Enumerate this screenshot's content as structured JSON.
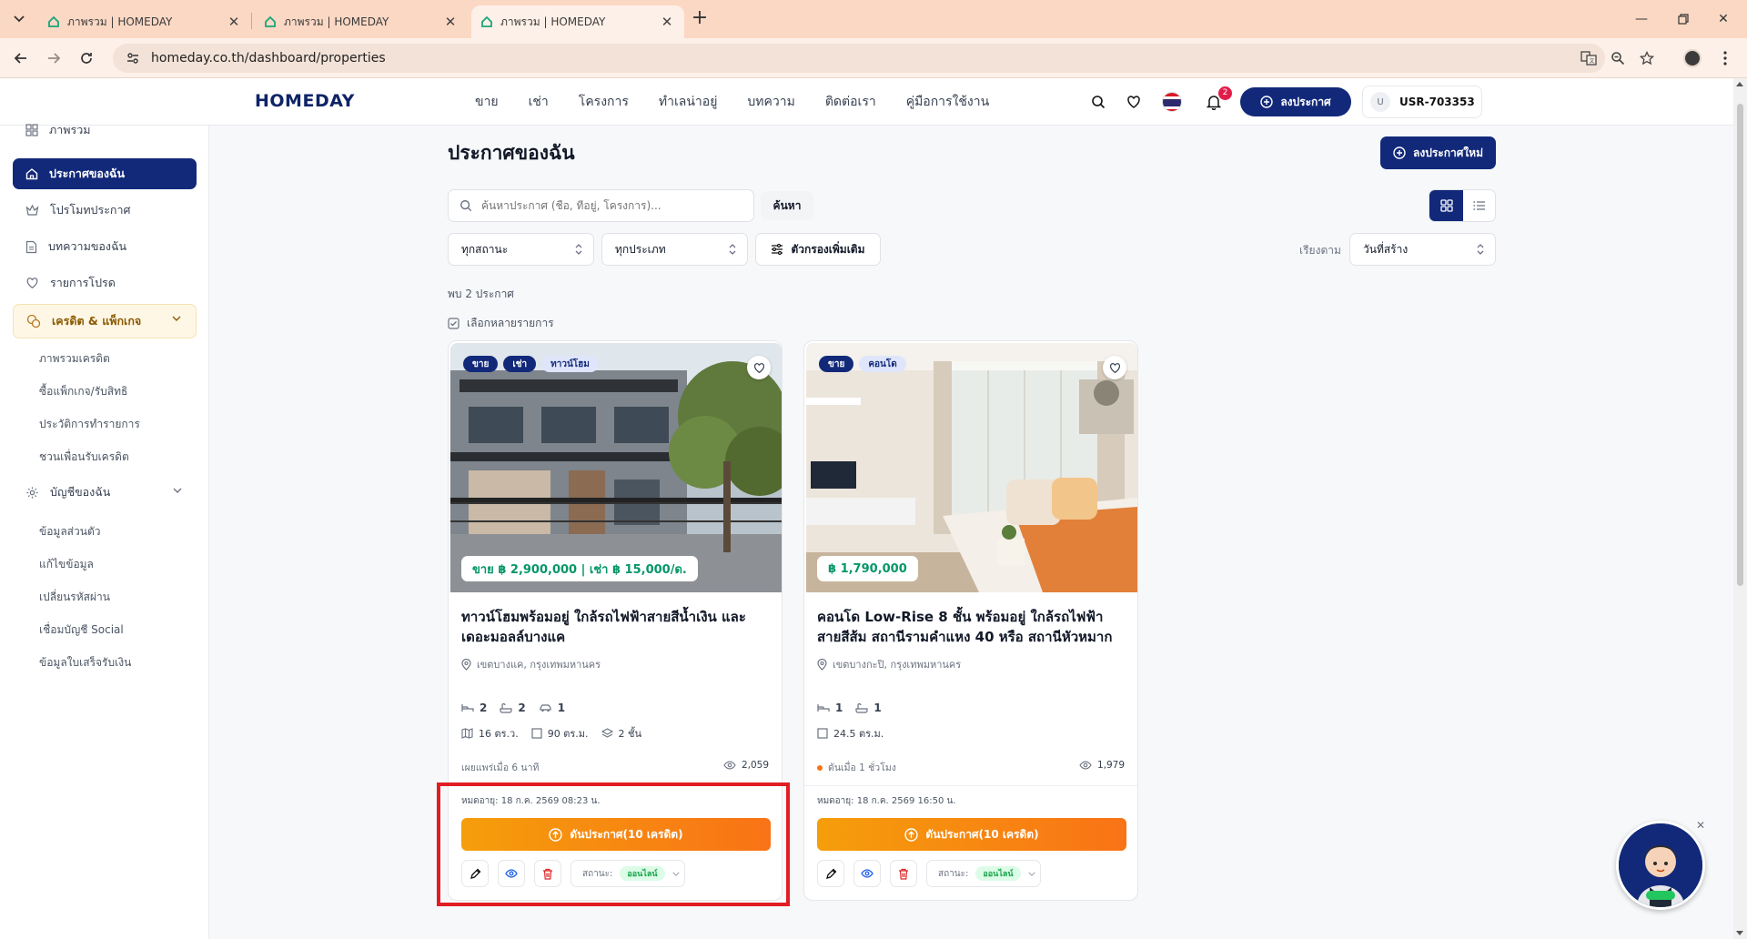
{
  "browser": {
    "tabs": [
      {
        "title": "ภาพรวม | HOMEDAY",
        "active": false
      },
      {
        "title": "ภาพรวม | HOMEDAY",
        "active": false
      },
      {
        "title": "ภาพรวม | HOMEDAY",
        "active": true
      }
    ],
    "url": "homeday.co.th/dashboard/properties"
  },
  "header": {
    "logo": "HOMEDAY",
    "nav": [
      "ขาย",
      "เช่า",
      "โครงการ",
      "ทำเลน่าอยู่",
      "บทความ",
      "ติดต่อเรา",
      "คู่มือการใช้งาน"
    ],
    "notification_count": "2",
    "post_button": "ลงประกาศ",
    "user_initial": "U",
    "user_id": "USR-703353"
  },
  "sidebar": {
    "items": [
      {
        "label": "ภาพรวม",
        "icon": "dashboard-icon"
      },
      {
        "label": "ประกาศของฉัน",
        "icon": "home-icon",
        "active": true
      },
      {
        "label": "โปรโมทประกาศ",
        "icon": "crown-icon"
      },
      {
        "label": "บทความของฉัน",
        "icon": "document-icon"
      },
      {
        "label": "รายการโปรด",
        "icon": "heart-icon"
      }
    ],
    "credit_group": {
      "label": "เครดิต & แพ็กเกจ",
      "children": [
        "ภาพรวมเครดิต",
        "ซื้อแพ็กเกจ/รับสิทธิ",
        "ประวัติการทำรายการ",
        "ชวนเพื่อนรับเครดิต"
      ]
    },
    "account_group": {
      "label": "บัญชีของฉัน",
      "children": [
        "ข้อมูลส่วนตัว",
        "แก้ไขข้อมูล",
        "เปลี่ยนรหัสผ่าน",
        "เชื่อมบัญชี Social",
        "ข้อมูลใบเสร็จรับเงิน"
      ]
    }
  },
  "main": {
    "title": "ประกาศของฉัน",
    "new_post_button": "ลงประกาศใหม่",
    "search_placeholder": "ค้นหาประกาศ (ชื่อ, ที่อยู่, โครงการ)...",
    "search_button": "ค้นหา",
    "status_filter": "ทุกสถานะ",
    "type_filter": "ทุกประเภท",
    "more_filters": "ตัวกรองเพิ่มเติม",
    "sort_label": "เรียงตาม",
    "sort_value": "วันที่สร้าง",
    "found_text": "พบ 2 ประกาศ",
    "multi_select": "เลือกหลายรายการ"
  },
  "listings": [
    {
      "tags": [
        "ขาย",
        "เช่า",
        "ทาวน์โฮม"
      ],
      "price": "ขาย ฿ 2,900,000 | เช่า ฿ 15,000/ด.",
      "title": "ทาวน์โฮมพร้อมอยู่ ใกล้รถไฟฟ้าสายสีน้ำเงิน และเดอะมอลล์บางแค",
      "location": "เขตบางแค, กรุงเทพมหานคร",
      "beds": "2",
      "baths": "2",
      "parking": "1",
      "land": "16 ตร.ว.",
      "area": "90 ตร.ม.",
      "floors": "2 ชั้น",
      "meta": "เผยแพร่เมื่อ 6 นาที",
      "views": "2,059",
      "expire": "หมดอายุ: 18 ก.ค. 2569 08:23 น.",
      "boost": "ดันประกาศ(10 เครดิต)",
      "status_label": "สถานะ:",
      "status": "ออนไลน์"
    },
    {
      "tags": [
        "ขาย",
        "คอนโด"
      ],
      "price": "฿ 1,790,000",
      "title": "คอนโด Low-Rise 8 ชั้น พร้อมอยู่ ใกล้รถไฟฟ้าสายสีส้ม สถานีรามคำแหง 40 หรือ สถานีหัวหมาก",
      "location": "เขตบางกะปิ, กรุงเทพมหานคร",
      "beds": "1",
      "baths": "1",
      "area": "24.5 ตร.ม.",
      "meta": "ดันเมื่อ 1 ชั่วโมง",
      "views": "1,979",
      "expire": "หมดอายุ: 18 ก.ค. 2569 16:50 น.",
      "boost": "ดันประกาศ(10 เครดิต)",
      "status_label": "สถานะ:",
      "status": "ออนไลน์"
    }
  ],
  "colors": {
    "brand": "#12297a",
    "boost": "#f97316",
    "price": "#059669",
    "highlight": "#e11d24"
  }
}
